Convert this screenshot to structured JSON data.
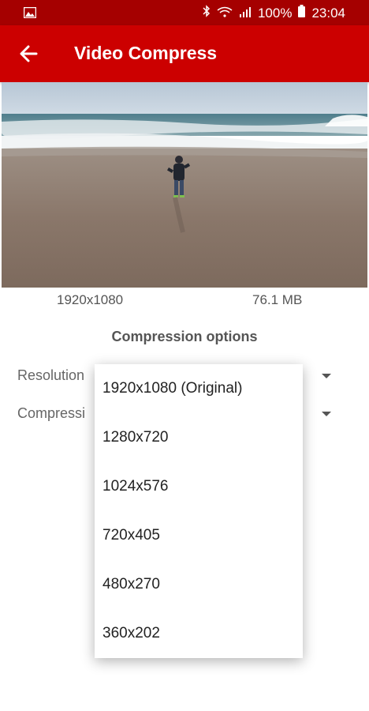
{
  "status_bar": {
    "battery": "100%",
    "time": "23:04"
  },
  "app_bar": {
    "title": "Video Compress",
    "back_icon": "arrow-back-icon"
  },
  "video": {
    "resolution": "1920x1080",
    "size": "76.1 MB"
  },
  "options": {
    "title": "Compression options",
    "resolution_label": "Resolution",
    "compression_label": "Compressi"
  },
  "dropdown": {
    "items": [
      "1920x1080 (Original)",
      "1280x720",
      "1024x576",
      "720x405",
      "480x270",
      "360x202"
    ]
  }
}
